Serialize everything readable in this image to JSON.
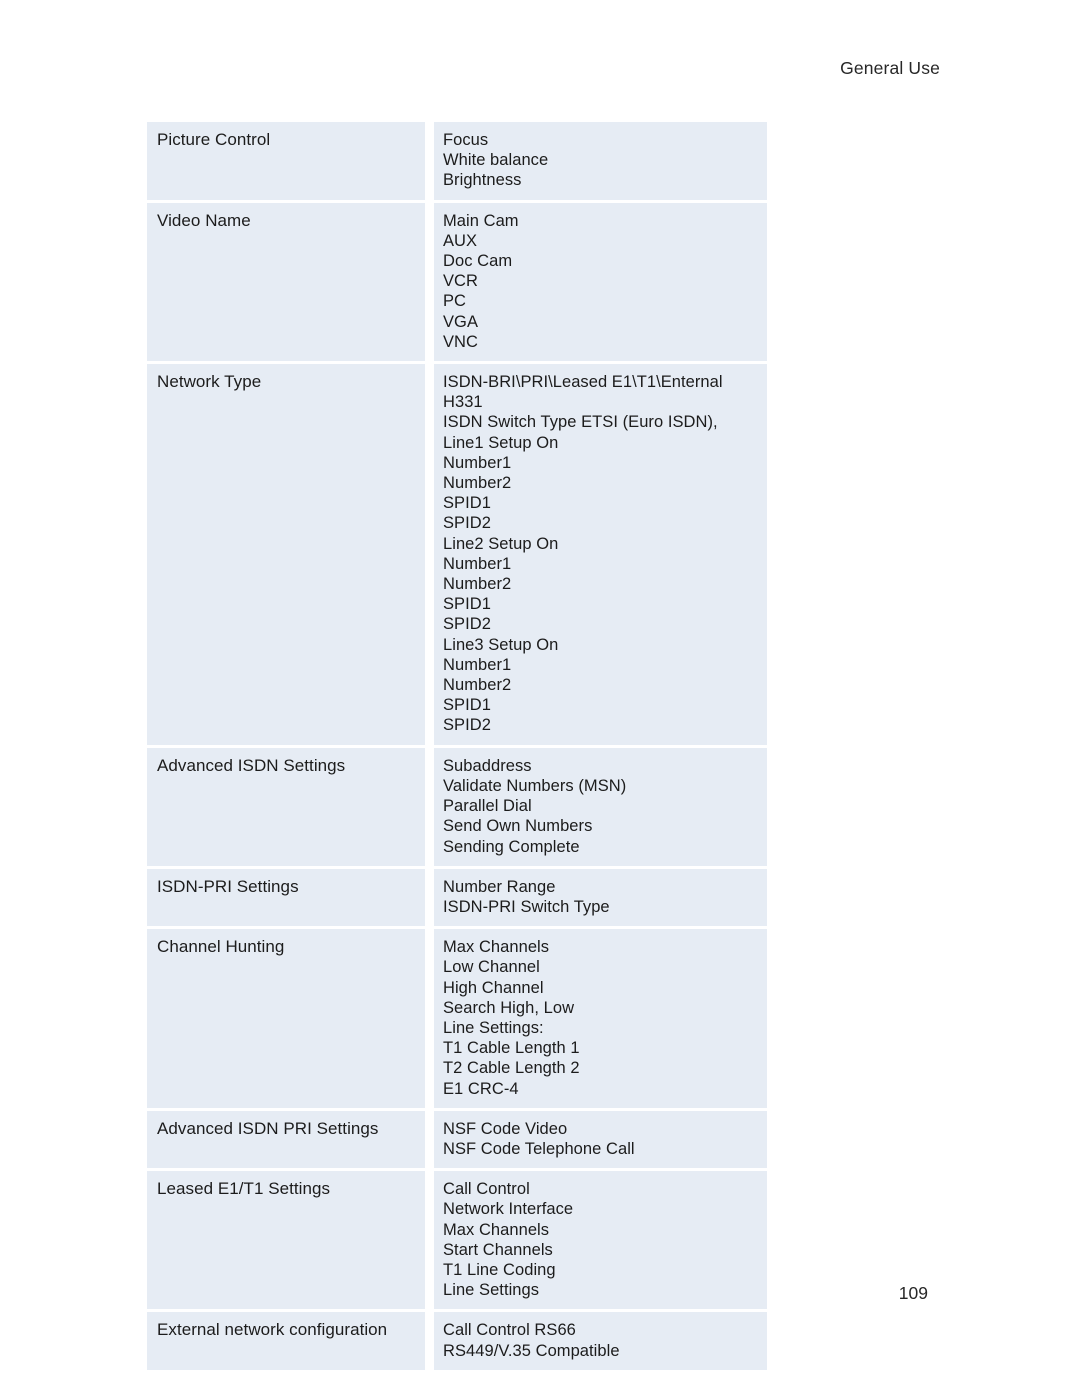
{
  "header": {
    "running_head": "General Use"
  },
  "footer": {
    "page_number": "109"
  },
  "table": {
    "rows": [
      {
        "label": "Picture Control",
        "values": [
          "Focus",
          "White balance",
          "Brightness"
        ]
      },
      {
        "label": "Video Name",
        "values": [
          "Main Cam",
          "AUX",
          "Doc Cam",
          "VCR",
          "PC",
          "VGA",
          "VNC"
        ]
      },
      {
        "label": "Network Type",
        "values": [
          "ISDN-BRI\\PRI\\Leased E1\\T1\\Enternal",
          "H331",
          "ISDN Switch Type ETSI (Euro ISDN),",
          "Line1 Setup On",
          "Number1",
          "Number2",
          "SPID1",
          "SPID2",
          "Line2 Setup On",
          "Number1",
          "Number2",
          "SPID1",
          "SPID2",
          "Line3 Setup On",
          "Number1",
          "Number2",
          "SPID1",
          "SPID2"
        ]
      },
      {
        "label": "Advanced ISDN Settings",
        "values": [
          "Subaddress",
          "Validate Numbers (MSN)",
          "Parallel Dial",
          "Send Own Numbers",
          "Sending Complete"
        ]
      },
      {
        "label": "ISDN-PRI Settings",
        "values": [
          "Number Range",
          "ISDN-PRI Switch Type"
        ]
      },
      {
        "label": "Channel Hunting",
        "values": [
          "Max Channels",
          "Low Channel",
          "High Channel",
          "Search High, Low",
          "Line Settings:",
          "T1 Cable Length 1",
          "T2 Cable Length 2",
          "E1 CRC-4"
        ]
      },
      {
        "label": "Advanced ISDN PRI Settings",
        "values": [
          "NSF Code Video",
          "NSF Code Telephone Call"
        ]
      },
      {
        "label": "Leased E1/T1 Settings",
        "values": [
          "Call Control",
          "Network Interface",
          "Max Channels",
          "Start Channels",
          "T1 Line Coding",
          "Line Settings"
        ]
      },
      {
        "label": "External network configuration",
        "values": [
          "Call Control RS66",
          "RS449/V.35 Compatible"
        ]
      }
    ]
  },
  "colors": {
    "cell_background": "#e6ecf4",
    "page_background": "#ffffff",
    "text": "#1c1c1c"
  }
}
